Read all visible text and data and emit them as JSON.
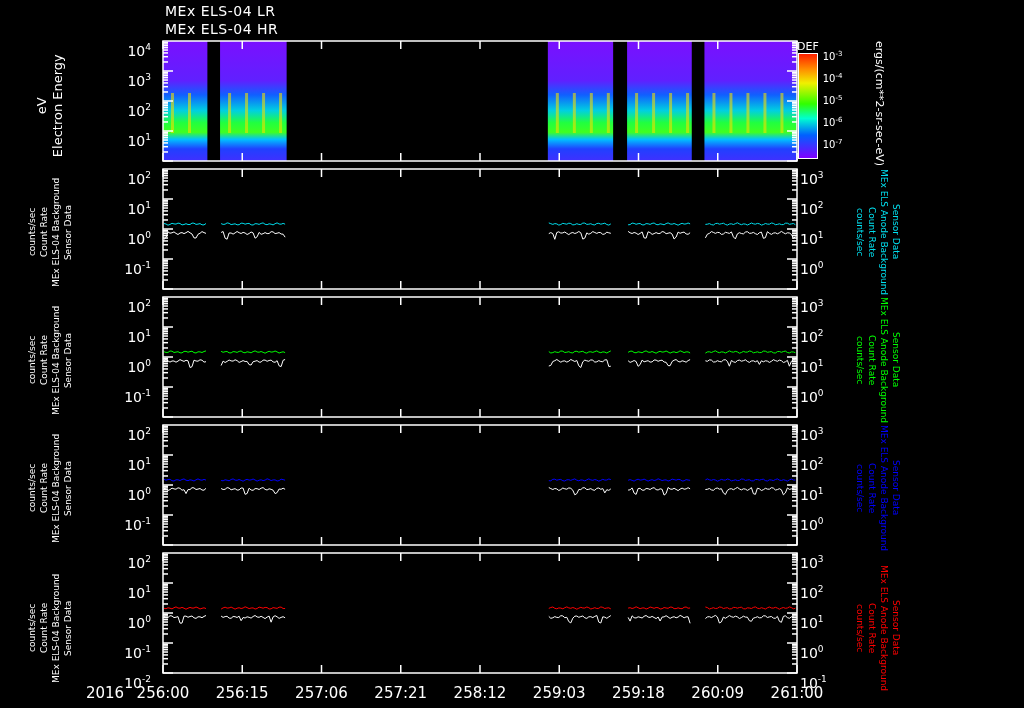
{
  "titles": [
    "MEx ELS-04 LR",
    "MEx ELS-04 HR"
  ],
  "spectrogram": {
    "ylabel": [
      "Electron Energy",
      "eV"
    ],
    "yticks": [
      "10$^{4}$",
      "10$^{3}$",
      "10$^{2}$",
      "10$^{1}$"
    ],
    "colorbar": {
      "title": "DEF",
      "ticks": [
        "10$^{-3}$",
        "10$^{-4}$",
        "10$^{-5}$",
        "10$^{-6}$",
        "10$^{-7}$"
      ],
      "unit": "ergs/(cm**2-sr-sec-eV)"
    }
  },
  "panels": [
    {
      "color": "#00e0f0",
      "left_label": [
        "Sensor Data",
        "MEx ELS-04 Background",
        "Count Rate",
        "counts/sec"
      ],
      "right_label": [
        "Sensor Data",
        "MEx ELS Anode Background",
        "Count Rate",
        "counts/sec"
      ],
      "left_ticks": [
        "10$^{2}$",
        "10$^{1}$",
        "10$^{0}$",
        "10$^{-1}$"
      ],
      "right_ticks": [
        "10$^{3}$",
        "10$^{2}$",
        "10$^{1}$",
        "10$^{0}$"
      ]
    },
    {
      "color": "#00ff00",
      "left_label": [
        "Sensor Data",
        "MEx ELS-04 Background",
        "Count Rate",
        "counts/sec"
      ],
      "right_label": [
        "Sensor Data",
        "MEx ELS Anode Background",
        "Count Rate",
        "counts/sec"
      ],
      "left_ticks": [
        "10$^{2}$",
        "10$^{1}$",
        "10$^{0}$",
        "10$^{-1}$"
      ],
      "right_ticks": [
        "10$^{3}$",
        "10$^{2}$",
        "10$^{1}$",
        "10$^{0}$"
      ]
    },
    {
      "color": "#0000ff",
      "left_label": [
        "Sensor Data",
        "MEx ELS-04 Background",
        "Count Rate",
        "counts/sec"
      ],
      "right_label": [
        "Sensor Data",
        "MEx ELS Anode Background",
        "Count Rate",
        "counts/sec"
      ],
      "left_ticks": [
        "10$^{2}$",
        "10$^{1}$",
        "10$^{0}$",
        "10$^{-1}$"
      ],
      "right_ticks": [
        "10$^{3}$",
        "10$^{2}$",
        "10$^{1}$",
        "10$^{0}$"
      ]
    },
    {
      "color": "#ff0000",
      "left_label": [
        "Sensor Data",
        "MEx ELS-04 Background",
        "Count Rate",
        "counts/sec"
      ],
      "right_label": [
        "Sensor Data",
        "MEx ELS Anode Background",
        "Count Rate",
        "counts/sec"
      ],
      "left_ticks": [
        "10$^{2}$",
        "10$^{1}$",
        "10$^{0}$",
        "10$^{-1}$",
        "10$^{-2}$"
      ],
      "right_ticks": [
        "10$^{3}$",
        "10$^{2}$",
        "10$^{1}$",
        "10$^{0}$",
        "10$^{-1}$"
      ]
    }
  ],
  "xaxis": {
    "year": "2016",
    "ticks": [
      "256:00",
      "256:15",
      "257:06",
      "257:21",
      "258:12",
      "259:03",
      "259:18",
      "260:09",
      "261:00"
    ]
  }
}
